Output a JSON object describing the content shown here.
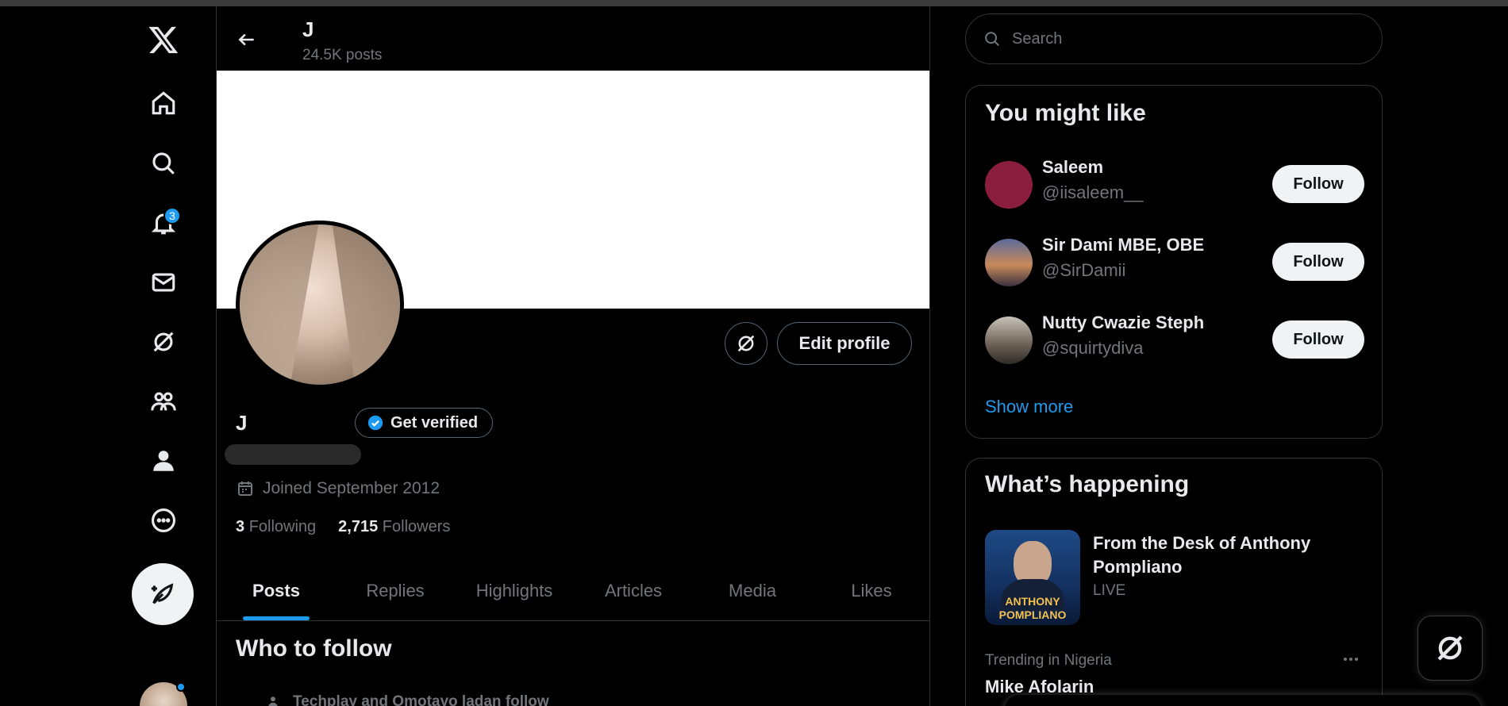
{
  "nav": {
    "items": [
      "home",
      "explore",
      "notifications",
      "messages",
      "grok",
      "communities",
      "profile",
      "more"
    ],
    "notifications_badge": "3"
  },
  "header": {
    "name": "J",
    "posts": "24.5K posts"
  },
  "profile": {
    "name": "J",
    "get_verified": "Get verified",
    "edit_profile": "Edit profile",
    "joined": "Joined September 2012",
    "following_count": "3",
    "following_label": "Following",
    "followers_count": "2,715",
    "followers_label": "Followers"
  },
  "tabs": [
    "Posts",
    "Replies",
    "Highlights",
    "Articles",
    "Media",
    "Likes"
  ],
  "who_to_follow": {
    "title": "Who to follow",
    "subtitle": "Techplay and Omotayo ladan follow"
  },
  "search": {
    "placeholder": "Search"
  },
  "you_might_like": {
    "title": "You might like",
    "users": [
      {
        "name": "Saleem",
        "handle": "@iisaleem__",
        "avatar_color": "#8b1e3f"
      },
      {
        "name": "Sir Dami MBE, OBE",
        "handle": "@SirDamii",
        "avatar_color": "#7a6a8a"
      },
      {
        "name": "Nutty Cwazie Steph",
        "handle": "@squirtydiva",
        "avatar_color": "#5b5148"
      }
    ],
    "follow_label": "Follow",
    "show_more": "Show more"
  },
  "whats_happening": {
    "title": "What’s happening",
    "live_item": {
      "title": "From the Desk of Anthony Pompliano",
      "status": "LIVE",
      "image_text_1": "ANTHONY",
      "image_text_2": "POMPLIANO"
    },
    "trend": {
      "category": "Trending in Nigeria",
      "name": "Mike Afolarin"
    }
  },
  "colors": {
    "accent": "#1d9bf0",
    "background": "#000000",
    "muted": "#71767b"
  }
}
